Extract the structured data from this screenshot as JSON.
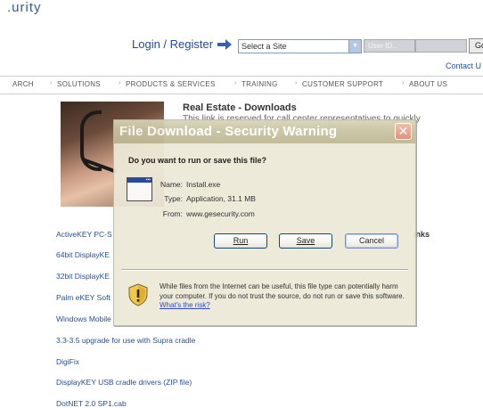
{
  "site": {
    "logo_fragment": ".urity",
    "login_label": "Login / Register",
    "site_select_value": "Select a Site",
    "user_id_placeholder": "User ID...",
    "go_label": "Go",
    "contact_label": "Contact U"
  },
  "nav": {
    "items": [
      "ARCH",
      "SOLUTIONS",
      "PRODUCTS & SERVICES",
      "TRAINING",
      "CUSTOMER SUPPORT",
      "ABOUT US"
    ]
  },
  "content": {
    "heading": "Real Estate - Downloads",
    "description": "This link is reserved for call center representatives to quickly",
    "links_heading_fragment": "inks",
    "links": [
      "ActiveKEY PC-S",
      "64bit DisplayKE",
      "32bit DisplayKE",
      "Palm eKEY Soft",
      "Windows Mobile",
      "3.3-3.5 upgrade for use with Supra cradle",
      "DigiFix",
      "DisplayKEY USB cradle drivers  (ZIP file)",
      "DotNET 2.0 SP1.cab"
    ]
  },
  "dialog": {
    "title": "File Download - Security Warning",
    "question": "Do you want to run or save this file?",
    "name_label": "Name:",
    "name_value": "Install.exe",
    "type_label": "Type:",
    "type_value": "Application, 31.1 MB",
    "from_label": "From:",
    "from_value": "www.gesecurity.com",
    "run_label": "Run",
    "save_label": "Save",
    "cancel_label": "Cancel",
    "warning_text": "While files from the Internet can be useful, this file type can potentially harm your computer. If you do not trust the source, do not run or save this software.",
    "risk_link": "What's the risk?"
  }
}
